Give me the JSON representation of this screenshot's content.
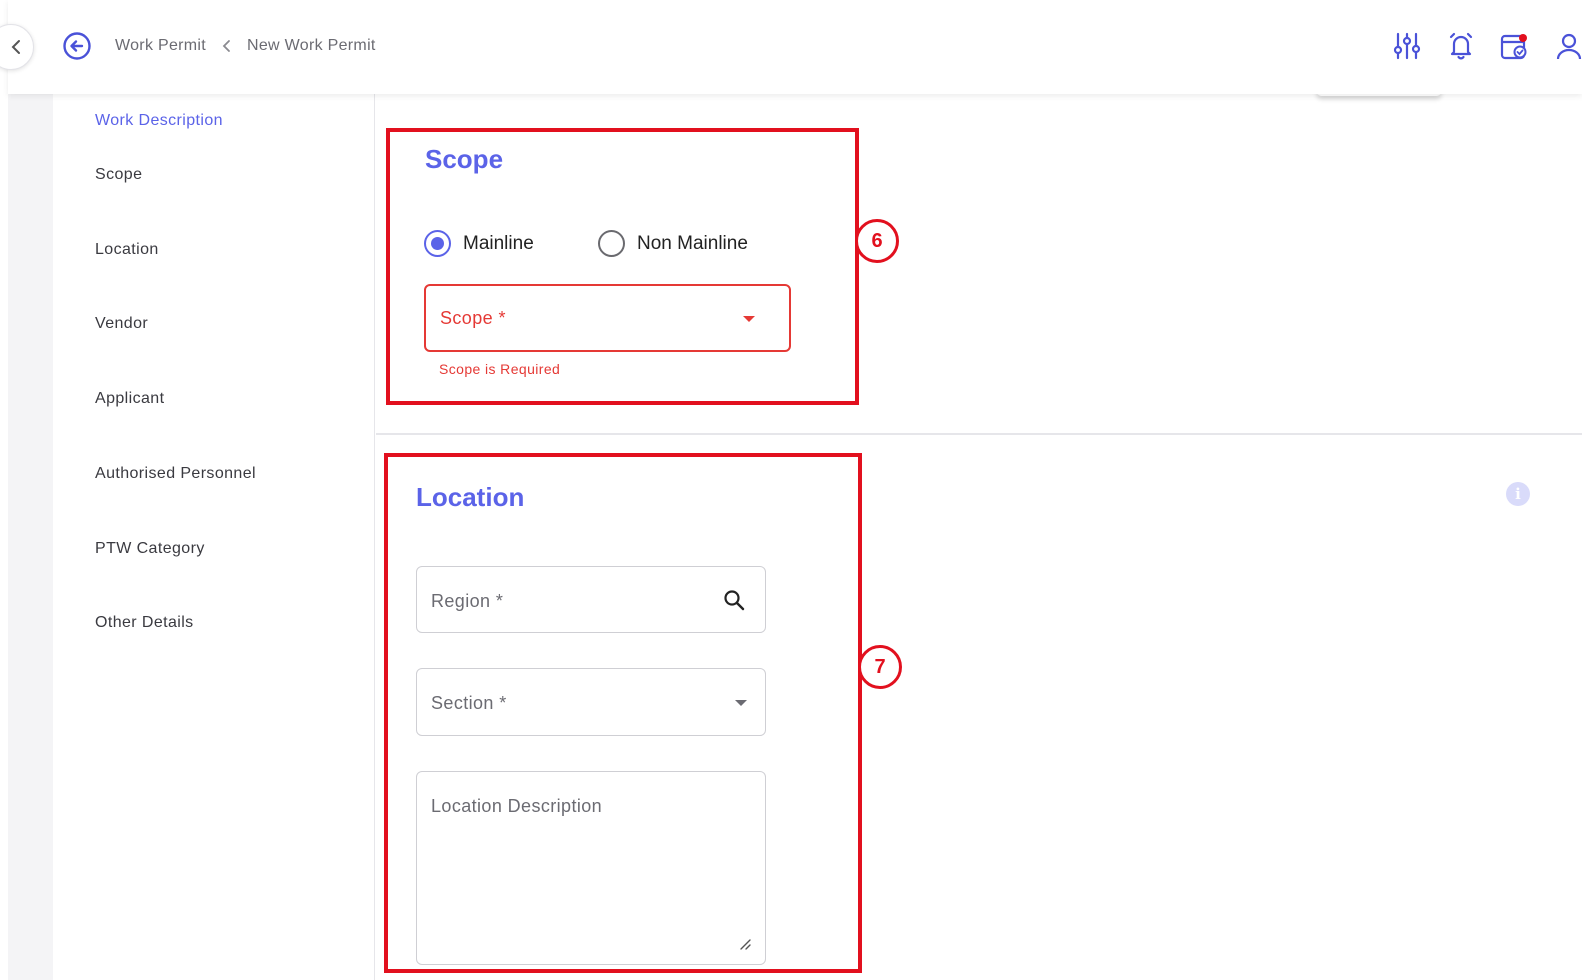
{
  "header": {
    "breadcrumb": [
      "Work Permit",
      "New Work Permit"
    ],
    "icons": [
      "back-arrow-icon",
      "filter-sliders-icon",
      "bell-icon",
      "calendar-check-icon",
      "user-icon"
    ],
    "notification_dot_color": "#e2101e"
  },
  "sidenav": {
    "items": [
      {
        "label": "Work Description",
        "active": true
      },
      {
        "label": "Scope"
      },
      {
        "label": "Location"
      },
      {
        "label": "Vendor"
      },
      {
        "label": "Applicant"
      },
      {
        "label": "Authorised Personnel"
      },
      {
        "label": "PTW Category"
      },
      {
        "label": "Other Details"
      }
    ]
  },
  "scope": {
    "title": "Scope",
    "options": [
      {
        "label": "Mainline",
        "selected": true
      },
      {
        "label": "Non Mainline",
        "selected": false
      }
    ],
    "select_label": "Scope *",
    "error": "Scope is Required"
  },
  "location": {
    "title": "Location",
    "region_label": "Region *",
    "section_label": "Section *",
    "description_label": "Location Description"
  },
  "annotations": {
    "scope_marker": "6",
    "location_marker": "7",
    "color": "#e2101e"
  },
  "colors": {
    "accent": "#5b63e8",
    "error": "#e53935"
  }
}
